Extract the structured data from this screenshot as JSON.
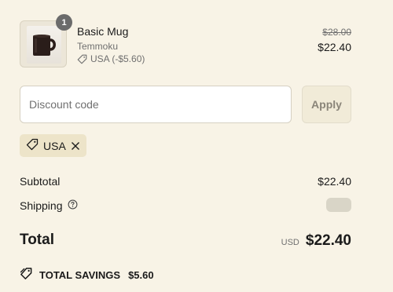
{
  "cart": {
    "item": {
      "quantity": "1",
      "name": "Basic Mug",
      "vendor": "Temmoku",
      "discount_label": "USA (-$5.60)",
      "original_price": "$28.00",
      "price": "$22.40",
      "image_icon": "mug-image"
    }
  },
  "discount": {
    "placeholder": "Discount code",
    "value": "",
    "apply_label": "Apply",
    "applied_code": "USA"
  },
  "summary": {
    "subtotal_label": "Subtotal",
    "subtotal_value": "$22.40",
    "shipping_label": "Shipping",
    "total_label": "Total",
    "currency": "USD",
    "total_value": "$22.40",
    "savings_label": "TOTAL SAVINGS",
    "savings_value": "$5.60"
  },
  "colors": {
    "background": "#f8f3e6",
    "chip": "#ede4c9",
    "apply_button": "#f1ebd8",
    "badge": "#6b6b6b"
  }
}
